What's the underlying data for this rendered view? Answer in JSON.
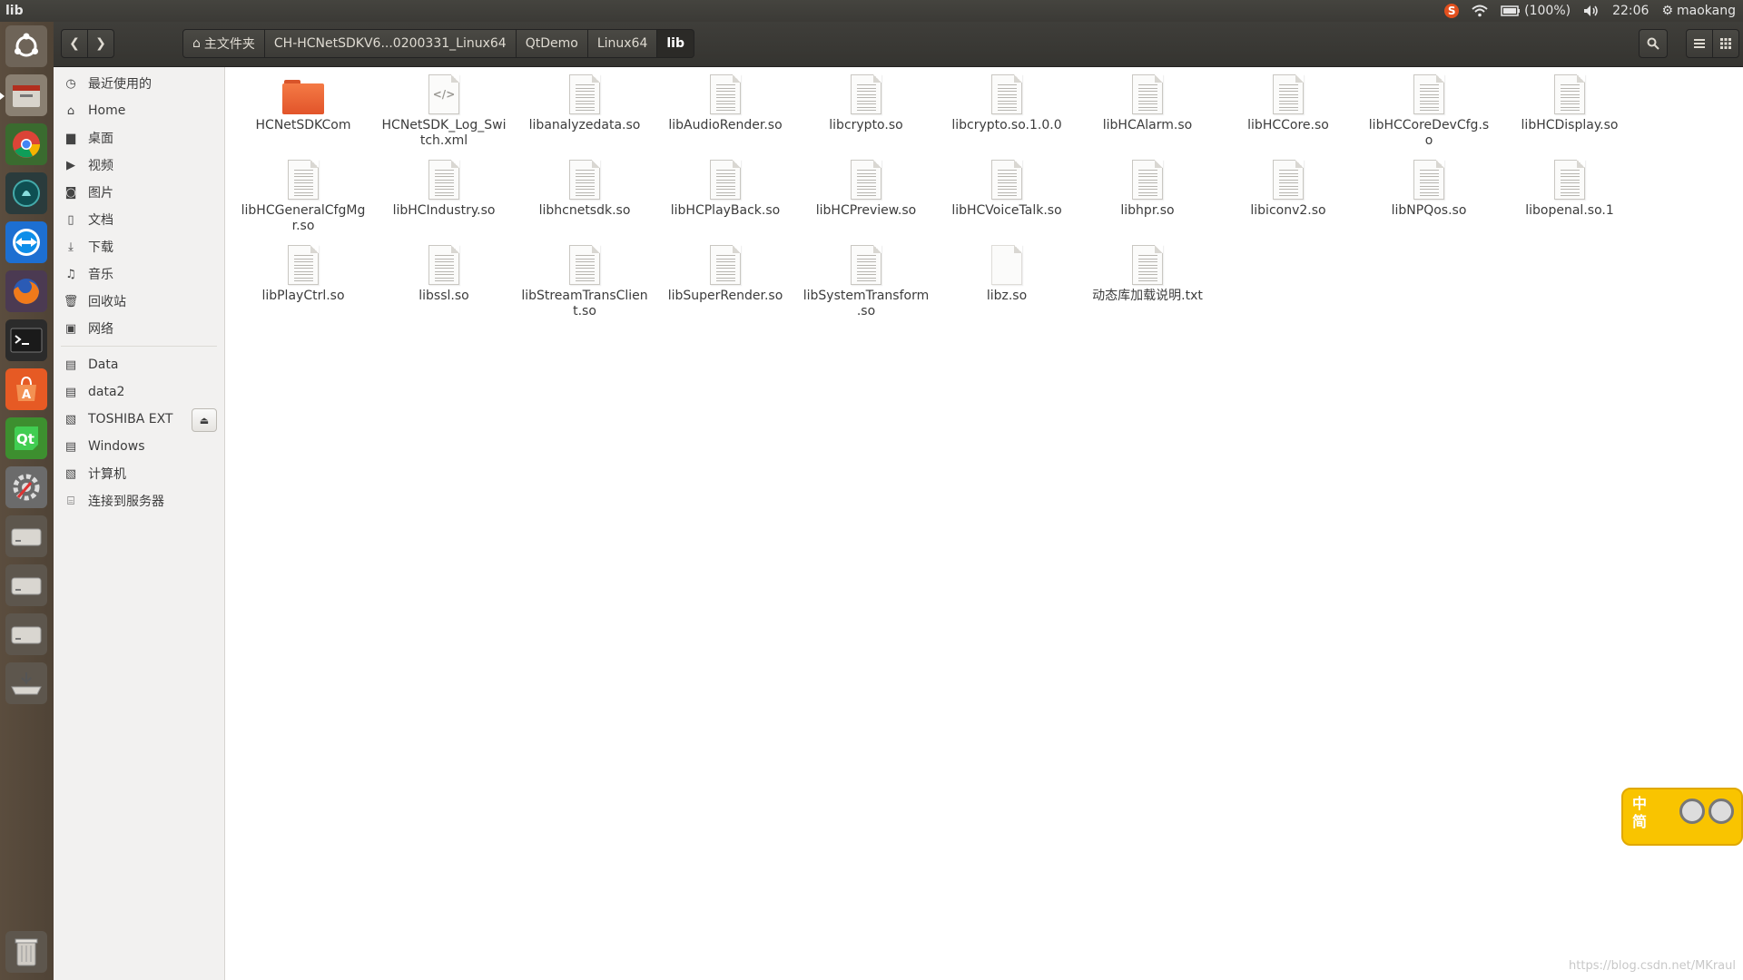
{
  "top_panel": {
    "window_title": "lib",
    "battery": "(100%)",
    "time": "22:06",
    "user": "maokang"
  },
  "header": {
    "home_crumb": "主文件夹",
    "crumbs": [
      "CH-HCNetSDKV6...0200331_Linux64",
      "QtDemo",
      "Linux64",
      "lib"
    ]
  },
  "sidebar": {
    "places": [
      "最近使用的",
      "Home",
      "桌面",
      "视频",
      "图片",
      "文档",
      "下载",
      "音乐",
      "回收站",
      "网络"
    ],
    "devices": [
      "Data",
      "data2",
      "TOSHIBA EXT",
      "Windows",
      "计算机",
      "连接到服务器"
    ]
  },
  "files": [
    {
      "name": "HCNetSDKCom",
      "kind": "folder"
    },
    {
      "name": "HCNetSDK_Log_Switch.xml",
      "kind": "xml"
    },
    {
      "name": "libanalyzedata.so",
      "kind": "doc"
    },
    {
      "name": "libAudioRender.so",
      "kind": "doc"
    },
    {
      "name": "libcrypto.so",
      "kind": "doc"
    },
    {
      "name": "libcrypto.so.1.0.0",
      "kind": "doc"
    },
    {
      "name": "libHCAlarm.so",
      "kind": "doc"
    },
    {
      "name": "libHCCore.so",
      "kind": "doc"
    },
    {
      "name": "libHCCoreDevCfg.so",
      "kind": "doc"
    },
    {
      "name": "libHCDisplay.so",
      "kind": "doc"
    },
    {
      "name": "libHCGeneralCfgMgr.so",
      "kind": "doc"
    },
    {
      "name": "libHCIndustry.so",
      "kind": "doc"
    },
    {
      "name": "libhcnetsdk.so",
      "kind": "doc"
    },
    {
      "name": "libHCPlayBack.so",
      "kind": "doc"
    },
    {
      "name": "libHCPreview.so",
      "kind": "doc"
    },
    {
      "name": "libHCVoiceTalk.so",
      "kind": "doc"
    },
    {
      "name": "libhpr.so",
      "kind": "doc"
    },
    {
      "name": "libiconv2.so",
      "kind": "doc"
    },
    {
      "name": "libNPQos.so",
      "kind": "doc"
    },
    {
      "name": "libopenal.so.1",
      "kind": "doc"
    },
    {
      "name": "libPlayCtrl.so",
      "kind": "doc"
    },
    {
      "name": "libssl.so",
      "kind": "doc"
    },
    {
      "name": "libStreamTransClient.so",
      "kind": "doc"
    },
    {
      "name": "libSuperRender.so",
      "kind": "doc"
    },
    {
      "name": "libSystemTransform.so",
      "kind": "doc"
    },
    {
      "name": "libz.so",
      "kind": "blank"
    },
    {
      "name": "动态库加载说明.txt",
      "kind": "doc"
    }
  ],
  "ime": {
    "line1": "中",
    "line2": "简"
  },
  "watermark": "https://blog.csdn.net/MKraul",
  "colors": {
    "folder": "#e8602f",
    "panel": "#3c3b37",
    "ime": "#f9c400"
  }
}
